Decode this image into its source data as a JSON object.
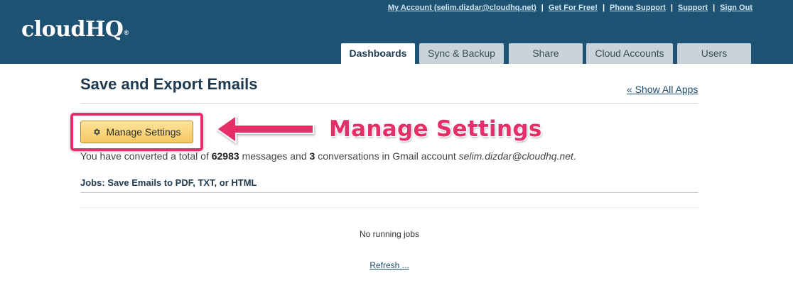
{
  "header": {
    "logo_text": "cloudHQ",
    "logo_mark": "®",
    "links": [
      "My Account (selim.dizdar@cloudhq.net)",
      "Get For Free!",
      "Phone Support",
      "Support",
      "Sign Out"
    ],
    "link_separator": "|"
  },
  "tabs": [
    "Dashboards",
    "Sync & Backup",
    "Share",
    "Cloud Accounts",
    "Users"
  ],
  "active_tab": "Dashboards",
  "page": {
    "title": "Save and Export Emails",
    "show_all_link": "« Show All Apps",
    "manage_button_label": "Manage Settings",
    "manage_button_icon": "gear-icon",
    "callout_text": "Manage Settings",
    "callout_arrow_icon": "arrow-left-icon",
    "highlight_color": "#e62e68",
    "summary": {
      "prefix": "You have converted a total of",
      "messages_count": "62983",
      "middle1": "messages and",
      "conversations_count": "3",
      "middle2": "conversations in Gmail account",
      "account": "selim.dizdar@cloudhq.net",
      "suffix": "."
    },
    "jobs_title": "Jobs: Save Emails to PDF, TXT, or HTML",
    "no_jobs_text": "No running jobs",
    "refresh_link": "Refresh ..."
  },
  "colors": {
    "header_bg": "#1d5273",
    "button_bg": "#f5c862",
    "accent": "#e62e68"
  }
}
